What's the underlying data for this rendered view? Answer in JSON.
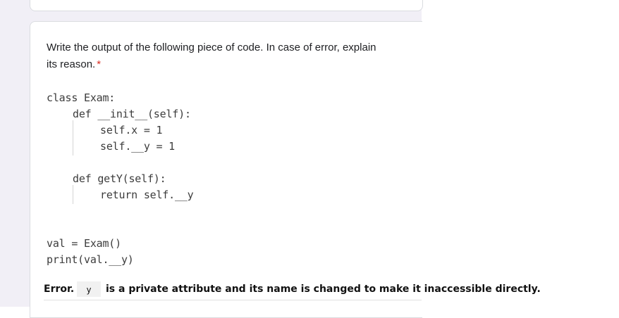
{
  "question": {
    "title_line1": "Write the output of the following piece of code. In case of error, explain",
    "title_line2": "its reason.",
    "required_marker": "*"
  },
  "code": {
    "lines": [
      "class Exam:",
      "def __init__(self):",
      "self.x = 1",
      "self.__y = 1",
      "def getY(self):",
      "return self.__y",
      "val = Exam()",
      "print(val.__y)"
    ]
  },
  "answer": {
    "prefix": "Error.",
    "inline_code": "y",
    "text": "is a private attribute and its name is changed to make it inaccessible directly."
  }
}
